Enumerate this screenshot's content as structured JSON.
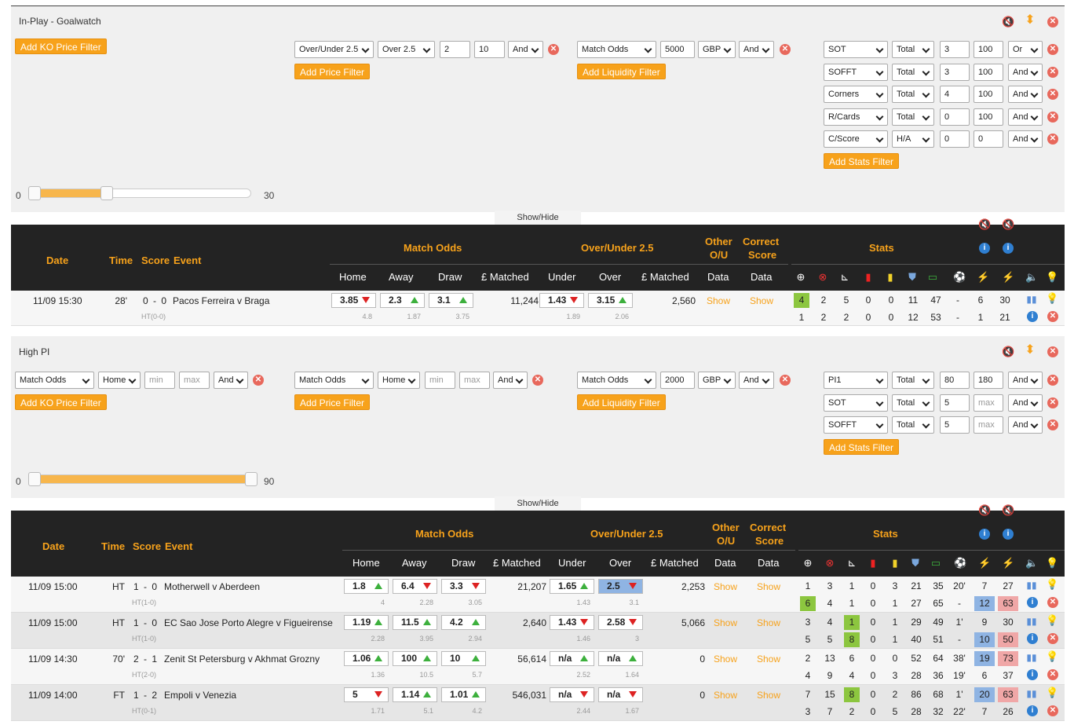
{
  "panel1": {
    "title": "In-Play - Goalwatch",
    "ko_btn": "Add KO Price Filter",
    "price": {
      "market": "Over/Under 2.5",
      "sel": "Over 2.5",
      "min": "2",
      "max": "10",
      "op": "And",
      "btn": "Add Price Filter"
    },
    "liq": {
      "market": "Match Odds",
      "amt": "5000",
      "cur": "GBP",
      "op": "And",
      "btn": "Add Liquidity Filter"
    },
    "stats": [
      {
        "stat": "SOT",
        "scope": "Total",
        "min": "3",
        "max": "100",
        "op": "Or"
      },
      {
        "stat": "SOFFT",
        "scope": "Total",
        "min": "3",
        "max": "100",
        "op": "And"
      },
      {
        "stat": "Corners",
        "scope": "Total",
        "min": "4",
        "max": "100",
        "op": "And"
      },
      {
        "stat": "R/Cards",
        "scope": "Total",
        "min": "0",
        "max": "100",
        "op": "And"
      },
      {
        "stat": "C/Score",
        "scope": "H/A",
        "min": "0",
        "max": "0",
        "op": "And"
      }
    ],
    "stats_btn": "Add Stats Filter",
    "slider": {
      "min_label": "0",
      "max_label": "30",
      "low": 0,
      "high": 30
    },
    "showhide": "Show/Hide"
  },
  "table_header": {
    "date": "Date",
    "time": "Time",
    "score": "Score",
    "event": "Event",
    "match_odds": "Match Odds",
    "ou": "Over/Under 2.5",
    "other": "Other",
    "other2": "O/U",
    "correct": "Correct",
    "correct2": "Score",
    "stats": "Stats",
    "home": "Home",
    "away": "Away",
    "draw": "Draw",
    "matched": "£ Matched",
    "under": "Under",
    "over": "Over",
    "matched2": "£ Matched",
    "data": "Data",
    "data2": "Data"
  },
  "table1": [
    {
      "date": "11/09 15:30",
      "time": "28'",
      "score": "0 - 0",
      "event": "Pacos Ferreira v Braga",
      "ht": "HT(0-0)",
      "home": "3.85",
      "home_dir": "down",
      "home_sub": "4.8",
      "away": "2.3",
      "away_dir": "up",
      "away_sub": "1.87",
      "draw": "3.1",
      "draw_dir": "up",
      "draw_sub": "3.75",
      "matched": "11,244",
      "under": "1.43",
      "under_dir": "down",
      "under_sub": "1.89",
      "over": "3.15",
      "over_dir": "up",
      "over_sub": "2.06",
      "matched2": "2,560",
      "show1": "Show",
      "show2": "Show",
      "s1": [
        "4",
        "2",
        "5",
        "0",
        "0",
        "11",
        "47",
        "-",
        "6",
        "30"
      ],
      "s2": [
        "1",
        "2",
        "2",
        "0",
        "0",
        "12",
        "53",
        "-",
        "1",
        "21"
      ]
    }
  ],
  "panel2": {
    "title": "High PI",
    "ko": {
      "market": "Match Odds",
      "sel": "Home",
      "min": "min",
      "max": "max",
      "op": "And",
      "btn": "Add KO Price Filter"
    },
    "price": {
      "market": "Match Odds",
      "sel": "Home",
      "min": "min",
      "max": "max",
      "op": "And",
      "btn": "Add Price Filter"
    },
    "liq": {
      "market": "Match Odds",
      "amt": "2000",
      "cur": "GBP",
      "op": "And",
      "btn": "Add Liquidity Filter"
    },
    "stats": [
      {
        "stat": "PI1",
        "scope": "Total",
        "min": "80",
        "max": "180",
        "op": "And"
      },
      {
        "stat": "SOT",
        "scope": "Total",
        "min": "5",
        "max": "max",
        "op": "And"
      },
      {
        "stat": "SOFFT",
        "scope": "Total",
        "min": "5",
        "max": "max",
        "op": "And"
      }
    ],
    "stats_btn": "Add Stats Filter",
    "slider": {
      "min_label": "0",
      "max_label": "90",
      "low": 0,
      "high": 90
    },
    "showhide": "Show/Hide"
  },
  "table2": [
    {
      "date": "11/09 15:00",
      "time": "HT",
      "score": "1 - 0",
      "event": "Motherwell v Aberdeen",
      "ht": "HT(1-0)",
      "home": "1.8",
      "home_dir": "up",
      "home_sub": "4",
      "away": "6.4",
      "away_dir": "down",
      "away_sub": "2.28",
      "draw": "3.3",
      "draw_dir": "down",
      "draw_sub": "3.05",
      "matched": "21,207",
      "under": "1.65",
      "under_dir": "up",
      "under_sub": "1.43",
      "over": "2.5",
      "over_dir": "down",
      "over_sub": "3.1",
      "matched2": "2,253",
      "show1": "Show",
      "show2": "Show",
      "s1": [
        "1",
        "3",
        "1",
        "0",
        "3",
        "21",
        "35",
        "20'",
        "7",
        "27"
      ],
      "s2": [
        "6",
        "4",
        "1",
        "0",
        "1",
        "27",
        "65",
        "-",
        "12",
        "63"
      ]
    },
    {
      "date": "11/09 15:00",
      "time": "HT",
      "score": "1 - 0",
      "event": "EC Sao Jose Porto Alegre v Figueirense",
      "ht": "HT(1-0)",
      "home": "1.19",
      "home_dir": "up",
      "home_sub": "2.28",
      "away": "11.5",
      "away_dir": "up",
      "away_sub": "3.95",
      "draw": "4.2",
      "draw_dir": "up",
      "draw_sub": "2.94",
      "matched": "2,640",
      "under": "1.43",
      "under_dir": "down",
      "under_sub": "1.46",
      "over": "2.58",
      "over_dir": "down",
      "over_sub": "3",
      "matched2": "5,066",
      "show1": "Show",
      "show2": "Show",
      "s1": [
        "3",
        "4",
        "1",
        "0",
        "1",
        "29",
        "49",
        "1'",
        "9",
        "30"
      ],
      "s2": [
        "5",
        "5",
        "8",
        "0",
        "1",
        "40",
        "51",
        "-",
        "10",
        "50"
      ]
    },
    {
      "date": "11/09 14:30",
      "time": "70'",
      "score": "2 - 1",
      "event": "Zenit St Petersburg v Akhmat Grozny",
      "ht": "HT(2-0)",
      "home": "1.06",
      "home_dir": "up",
      "home_sub": "1.36",
      "away": "100",
      "away_dir": "up",
      "away_sub": "10.5",
      "draw": "10",
      "draw_dir": "up",
      "draw_sub": "5.7",
      "matched": "56,614",
      "under": "n/a",
      "under_dir": "up",
      "under_sub": "2.52",
      "over": "n/a",
      "over_dir": "up",
      "over_sub": "1.64",
      "matched2": "0",
      "show1": "Show",
      "show2": "Show",
      "s1": [
        "2",
        "13",
        "6",
        "0",
        "0",
        "52",
        "64",
        "38'",
        "19",
        "73"
      ],
      "s2": [
        "4",
        "9",
        "4",
        "0",
        "3",
        "28",
        "36",
        "19'",
        "6",
        "37"
      ]
    },
    {
      "date": "11/09 14:00",
      "time": "FT",
      "score": "1 - 2",
      "event": "Empoli v Venezia",
      "ht": "HT(0-1)",
      "home": "5",
      "home_dir": "down",
      "home_sub": "1.71",
      "away": "1.14",
      "away_dir": "up",
      "away_sub": "5.1",
      "draw": "1.01",
      "draw_dir": "up",
      "draw_sub": "4.2",
      "matched": "546,031",
      "under": "n/a",
      "under_dir": "down",
      "under_sub": "2.44",
      "over": "n/a",
      "over_dir": "down",
      "over_sub": "1.67",
      "matched2": "0",
      "show1": "Show",
      "show2": "Show",
      "s1": [
        "7",
        "15",
        "8",
        "0",
        "2",
        "86",
        "68",
        "1'",
        "20",
        "63"
      ],
      "s2": [
        "3",
        "7",
        "2",
        "0",
        "5",
        "28",
        "32",
        "22'",
        "7",
        "26"
      ]
    }
  ],
  "colors": {
    "accent": "#f7a21b",
    "header_bg": "#232323",
    "green": "#8cc63f",
    "blue": "#8fb4e3",
    "red": "#f0a7a7"
  },
  "icons": [
    "sound-off-icon",
    "sort-icon",
    "close-icon",
    "crosshair-icon",
    "target-icon",
    "corner-flag-icon",
    "red-card-icon",
    "yellow-card-icon",
    "shield-icon",
    "pitch-icon",
    "ball-icon",
    "lightning-icon",
    "chart-icon",
    "bulb-icon",
    "info-icon"
  ]
}
